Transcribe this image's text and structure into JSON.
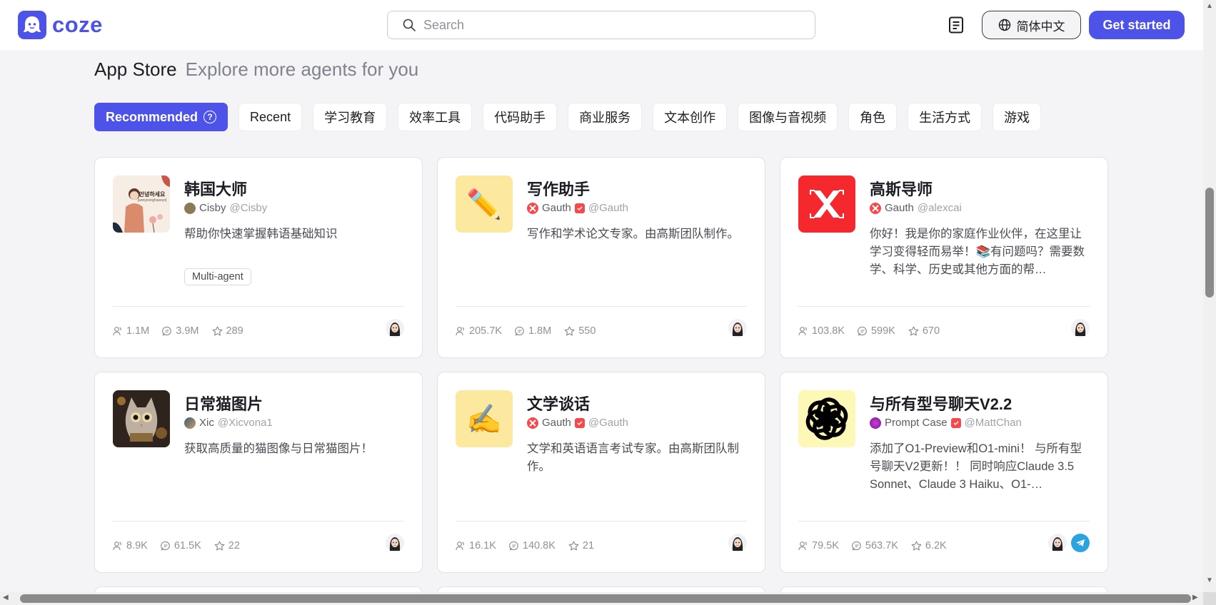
{
  "header": {
    "brand": "coze",
    "search_placeholder": "Search",
    "language_label": "简体中文",
    "cta_label": "Get started",
    "brand_color": "#4d53e8"
  },
  "page": {
    "title": "App Store",
    "subtitle": "Explore more agents for you"
  },
  "tabs": [
    {
      "label": "Recommended",
      "active": true
    },
    {
      "label": "Recent"
    },
    {
      "label": "学习教育"
    },
    {
      "label": "效率工具"
    },
    {
      "label": "代码助手"
    },
    {
      "label": "商业服务"
    },
    {
      "label": "文本创作"
    },
    {
      "label": "图像与音视频"
    },
    {
      "label": "角色"
    },
    {
      "label": "生活方式"
    },
    {
      "label": "游戏"
    }
  ],
  "cards": [
    {
      "title": "韩国大师",
      "author": "Cisby",
      "handle": "@Cisby",
      "description": "帮助你快速掌握韩语基础知识",
      "tag": "Multi-agent",
      "users": "1.1M",
      "chats": "3.9M",
      "stars": "289",
      "thumb_text": "안녕하세요",
      "thumb_caption": "[annyeonghaseyo]"
    },
    {
      "title": "写作助手",
      "author": "Gauth",
      "handle": "@Gauth",
      "description": "写作和学术论文专家。由高斯团队制作。",
      "users": "205.7K",
      "chats": "1.8M",
      "stars": "550",
      "thumb_emoji": "✏️"
    },
    {
      "title": "高斯导师",
      "author": "Gauth",
      "handle": "@alexcai",
      "description": "你好！我是你的家庭作业伙伴，在这里让学习变得轻而易举！📚有问题吗？需要数学、科学、历史或其他方面的帮…",
      "users": "103.8K",
      "chats": "599K",
      "stars": "670"
    },
    {
      "title": "日常猫图片",
      "author": "Xic",
      "handle": "@Xicvona1",
      "description": "获取高质量的猫图像与日常猫图片！",
      "users": "8.9K",
      "chats": "61.5K",
      "stars": "22"
    },
    {
      "title": "文学谈话",
      "author": "Gauth",
      "handle": "@Gauth",
      "description": "文学和英语语言考试专家。由高斯团队制作。",
      "users": "16.1K",
      "chats": "140.8K",
      "stars": "21",
      "thumb_emoji": "✍️"
    },
    {
      "title": "与所有型号聊天V2.2",
      "author": "Prompt Case",
      "handle": "@MattChan",
      "description": "添加了O1-Preview和O1-mini！ 与所有型号聊天V2更新！！ 同时响应Claude 3.5 Sonnet、Claude 3 Haiku、O1-…",
      "users": "79.5K",
      "chats": "563.7K",
      "stars": "6.2K"
    }
  ]
}
